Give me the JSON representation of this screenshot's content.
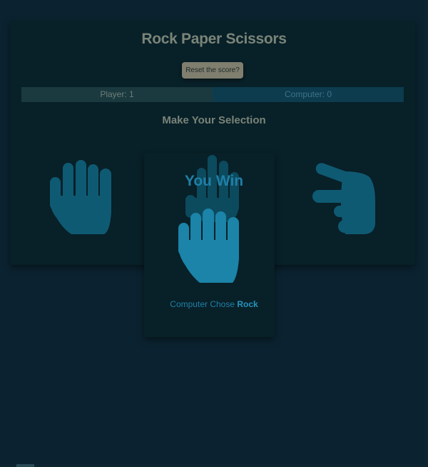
{
  "game": {
    "title": "Rock Paper Scissors",
    "reset_label": "Reset the score?",
    "player_score_label": "Player: 1",
    "computer_score_label": "Computer: 0",
    "prompt": "Make Your Selection",
    "result": "You Win",
    "computer_chose_prefix": "Computer Chose ",
    "computer_choice": "Rock"
  },
  "choices": [
    {
      "name": "rock-choice",
      "icon": "fist-icon"
    },
    {
      "name": "paper-choice",
      "icon": "open-hand-icon"
    },
    {
      "name": "scissors-choice",
      "icon": "two-fingers-icon"
    }
  ],
  "colors": {
    "background": "#0b2330",
    "card": "#082028",
    "accent": "#1f7fa6",
    "hand_dim": "#0f5a73",
    "hand_bright": "#1b84a8",
    "text_muted": "#7a8478"
  }
}
